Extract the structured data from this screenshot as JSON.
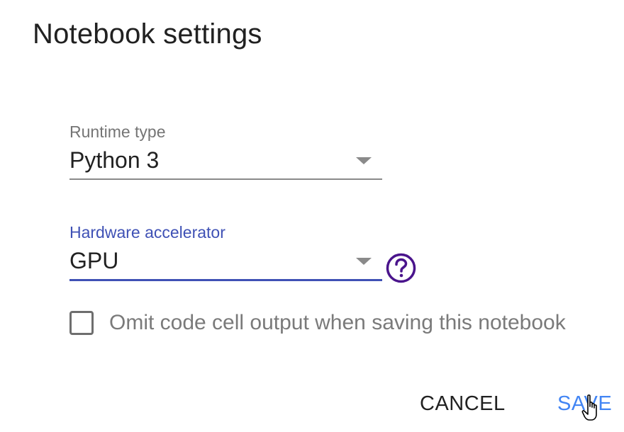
{
  "dialog": {
    "title": "Notebook settings"
  },
  "runtime": {
    "label": "Runtime type",
    "value": "Python 3"
  },
  "hardware": {
    "label": "Hardware accelerator",
    "value": "GPU",
    "help_icon": "help-circle-icon"
  },
  "omit_output": {
    "label": "Omit code cell output when saving this notebook",
    "checked": false
  },
  "actions": {
    "cancel_label": "CANCEL",
    "save_label": "SAVE"
  },
  "colors": {
    "accent": "#3f51b5",
    "save": "#4285f4",
    "help_icon": "#4a148c"
  }
}
